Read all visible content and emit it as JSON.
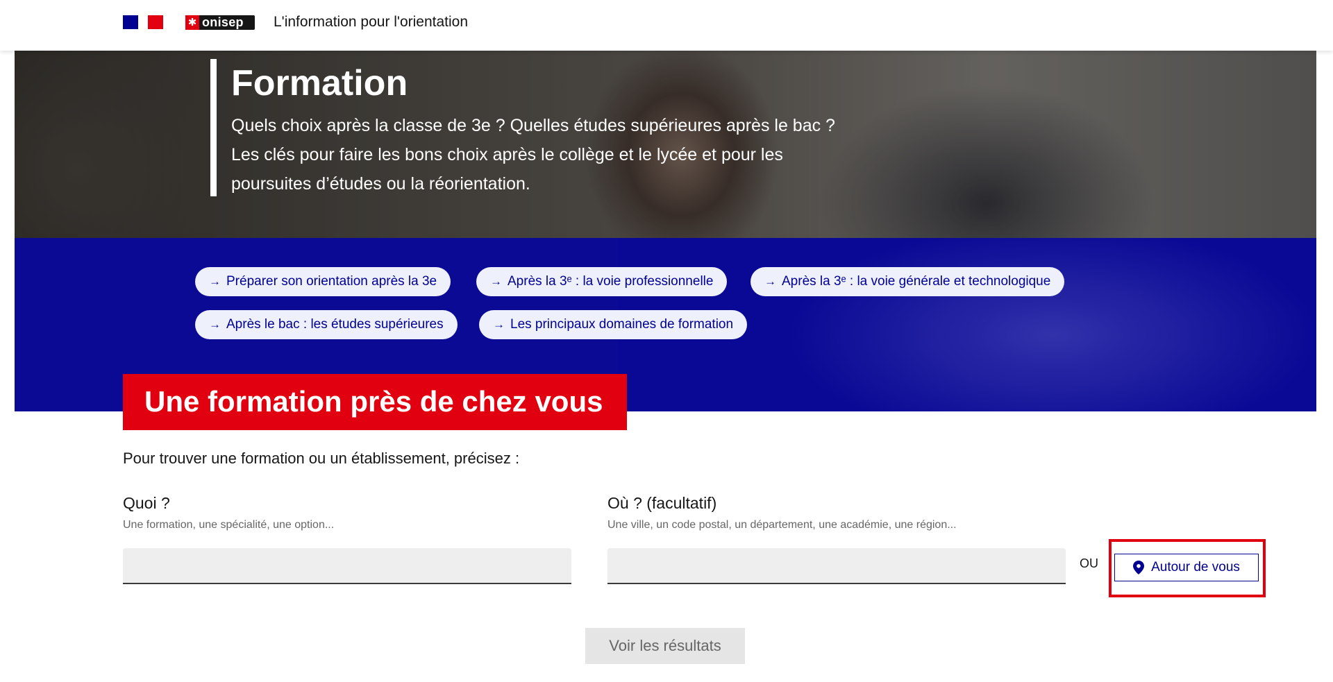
{
  "header": {
    "tagline": "L'information pour l'orientation",
    "logo_text": "onisep",
    "republique_logo": "marianne-logo"
  },
  "hero": {
    "title": "Formation",
    "description": "Quels choix après la classe de 3e ? Quelles études supérieures après le bac ? Les clés pour faire les bons choix après le collège et le lycée et pour les poursuites d’études ou la réorientation.",
    "chips": [
      {
        "label": "Préparer son orientation après la 3e"
      },
      {
        "label": "Après la 3ᵉ : la voie professionnelle"
      },
      {
        "label": "Après la 3ᵉ : la voie générale et technologique"
      },
      {
        "label": "Après le bac : les études supérieures"
      },
      {
        "label": "Les principaux domaines de formation"
      }
    ],
    "chip_icon": "arrow-right-icon"
  },
  "search": {
    "heading": "Une formation près de chez vous",
    "intro": "Pour trouver une formation ou un établissement, précisez :",
    "what_label": "Quoi ?",
    "what_hint": "Une formation, une spécialité, une option...",
    "what_value": "",
    "where_label": "Où ? (facultatif)",
    "where_hint": "Une ville, un code postal, un département, une académie, une région...",
    "where_value": "",
    "or_text": "OU",
    "around_button": "Autour de vous",
    "around_icon": "location-pin-icon",
    "submit_button": "Voir les résultats"
  },
  "colors": {
    "brand_blue": "#000091",
    "brand_red": "#e1000f",
    "chip_bg": "#eef0fb"
  }
}
